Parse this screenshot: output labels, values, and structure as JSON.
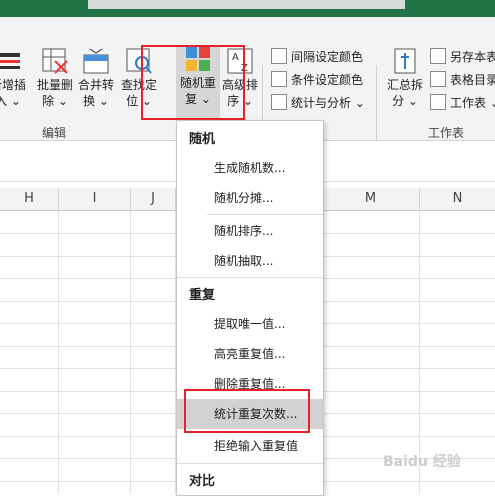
{
  "ribbon": {
    "buttons": [
      {
        "line1": "新增插",
        "line2": "入 ⌄"
      },
      {
        "line1": "批量删",
        "line2": "除 ⌄"
      },
      {
        "line1": "合并转",
        "line2": "换 ⌄"
      },
      {
        "line1": "查找定",
        "line2": "位 ⌄"
      },
      {
        "line1": "随机重",
        "line2": "复 ⌄"
      },
      {
        "line1": "高级排",
        "line2": "序 ⌄"
      }
    ],
    "group_edit": "编辑",
    "small_mid": [
      "间隔设定颜色",
      "条件设定颜色",
      "统计与分析 ⌄"
    ],
    "summary_button": {
      "line1": "汇总拆",
      "line2": "分 ⌄"
    },
    "small_right": [
      "另存本表",
      "表格目录",
      "工作表 ⌄"
    ],
    "group_sheet": "工作表"
  },
  "columns": [
    "H",
    "I",
    "J",
    "M",
    "N"
  ],
  "menu": {
    "sections": [
      {
        "header": "随机",
        "items": [
          "生成随机数...",
          "随机分摊...",
          "随机排序...",
          "随机抽取..."
        ]
      },
      {
        "header": "重复",
        "items": [
          "提取唯一值...",
          "高亮重复值...",
          "删除重复值...",
          "统计重复次数...",
          "拒绝输入重复值"
        ]
      },
      {
        "header": "对比",
        "items": []
      }
    ]
  },
  "watermark": "Baidu 经验",
  "colors": {
    "title_green": "#227447",
    "highlight_red": "#e8202a"
  }
}
